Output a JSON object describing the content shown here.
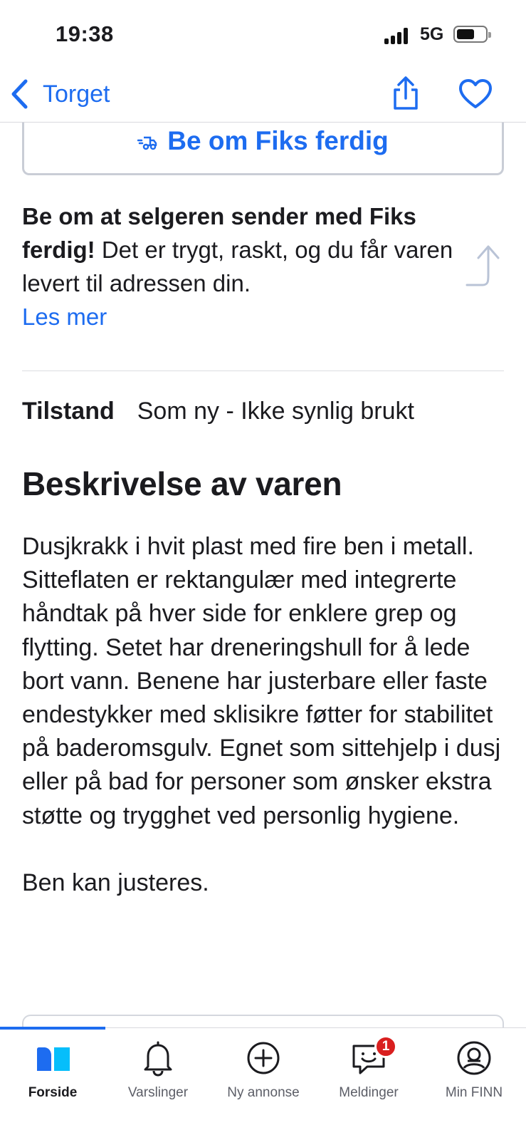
{
  "status_bar": {
    "time": "19:38",
    "network": "5G",
    "icons": [
      "signal-icon",
      "battery-icon"
    ]
  },
  "nav": {
    "back_label": "Torget",
    "back_icon": "chevron-left-icon",
    "share_icon": "share-icon",
    "favorite_icon": "heart-icon"
  },
  "fiks_button": {
    "label": "Be om Fiks ferdig",
    "icon": "delivery-truck-icon"
  },
  "promo": {
    "bold_text": "Be om at selgeren sender med Fiks ferdig!",
    "body_text": " Det er trygt, raskt, og du får varen levert til adressen din.",
    "read_more": "Les mer"
  },
  "condition": {
    "label": "Tilstand",
    "value": "Som ny - Ikke synlig brukt"
  },
  "description": {
    "title": "Beskrivelse av varen",
    "paragraphs": [
      "Dusjkrakk i hvit plast med fire ben i metall. Sitteflaten er rektangulær med integrerte håndtak på hver side for enklere grep og flytting. Setet har dreneringshull for å lede bort vann. Benene har justerbare eller faste endestykker med sklisikre føtter for stabilitet på baderomsgulv. Egnet som sittehjelp i dusj eller på bad for personer som ønsker ekstra støtte og trygghet ved personlig hygiene.",
      "Ben kan justeres."
    ]
  },
  "tab_bar": {
    "tabs": [
      {
        "label": "Forside",
        "icon": "home-icon",
        "active": true
      },
      {
        "label": "Varslinger",
        "icon": "bell-icon",
        "active": false
      },
      {
        "label": "Ny annonse",
        "icon": "plus-circle-icon",
        "active": false
      },
      {
        "label": "Meldinger",
        "icon": "chat-icon",
        "active": false,
        "badge": "1"
      },
      {
        "label": "Min FINN",
        "icon": "profile-icon",
        "active": false
      }
    ]
  },
  "colors": {
    "accent": "#1d6cf0",
    "text": "#1b1b1f",
    "badge": "#d91f1f",
    "home_left": "#1d6cf0",
    "home_right": "#06befb"
  }
}
